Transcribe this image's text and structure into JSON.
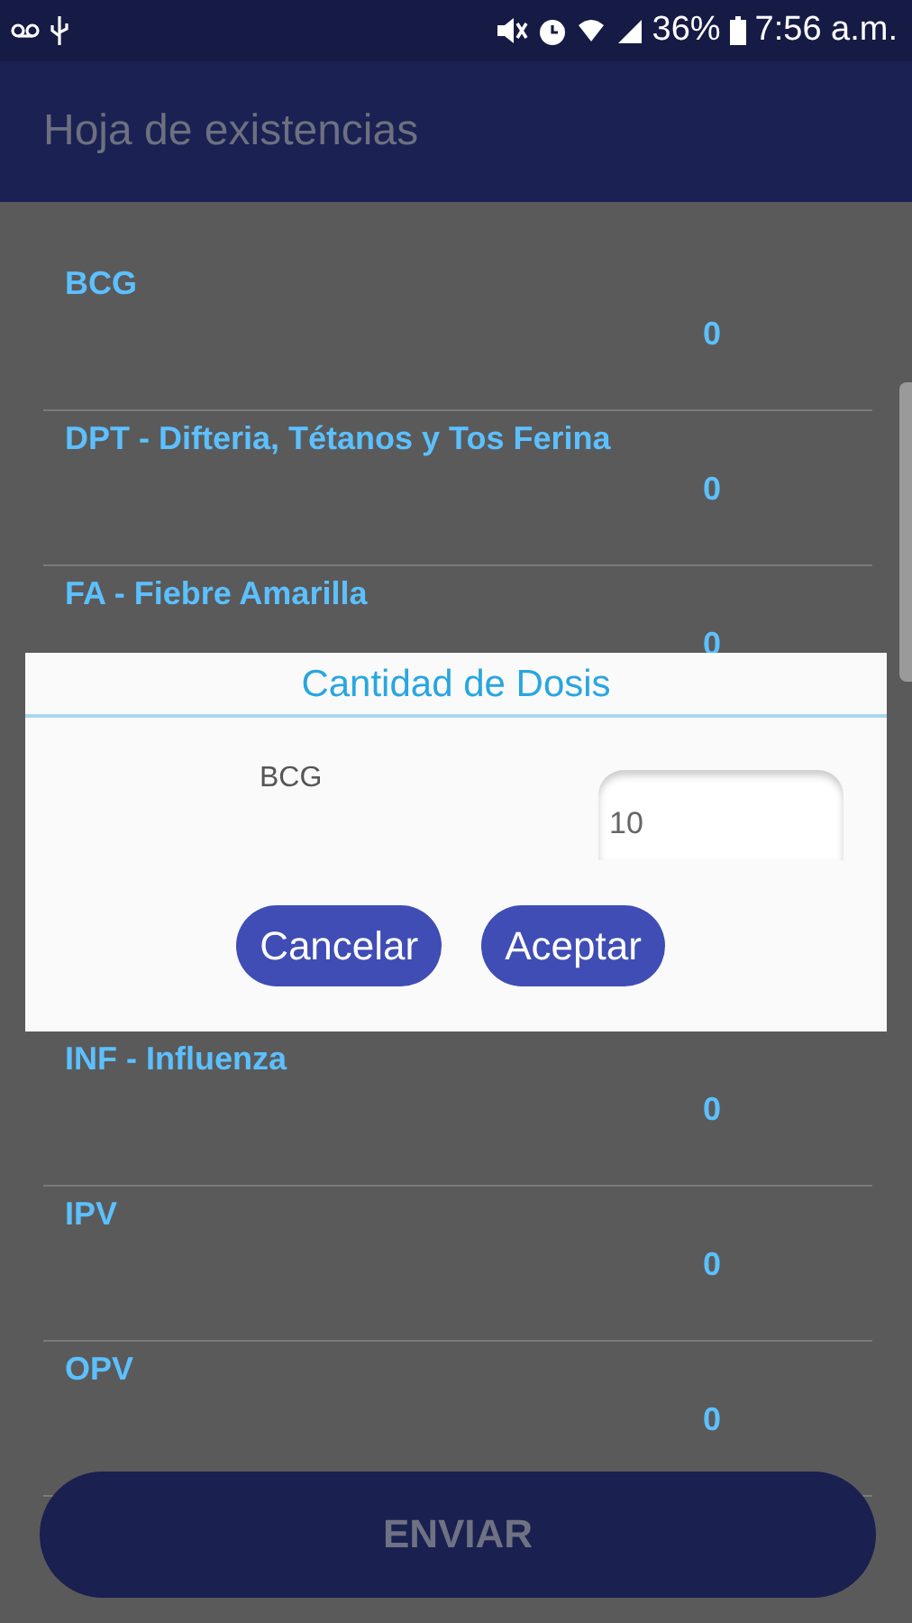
{
  "status_bar": {
    "battery": "36%",
    "time": "7:56 a.m."
  },
  "app_bar": {
    "title": "Hoja de existencias"
  },
  "list": {
    "above_dialog": [
      {
        "name": "BCG",
        "value": "0"
      },
      {
        "name": "DPT - Difteria, Tétanos y Tos Ferina",
        "value": "0"
      },
      {
        "name": "FA - Fiebre Amarilla",
        "value": "0"
      }
    ],
    "below_dialog": [
      {
        "name": "INF - Influenza",
        "value": "0"
      },
      {
        "name": "IPV",
        "value": "0"
      },
      {
        "name": "OPV",
        "value": "0"
      }
    ]
  },
  "dialog": {
    "title": "Cantidad de Dosis",
    "label": "BCG",
    "input_value": "10",
    "buttons": [
      "Cancelar",
      "Aceptar"
    ]
  },
  "send_button": {
    "label": "ENVIAR",
    "disabled": true
  }
}
